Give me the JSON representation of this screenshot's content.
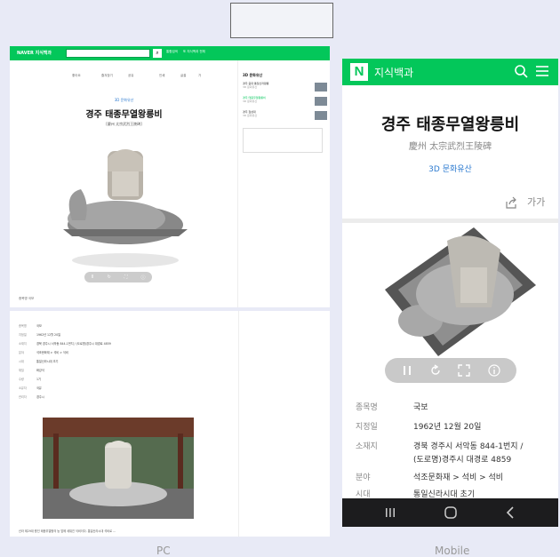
{
  "labels": {
    "pc": "PC",
    "mobile": "Mobile"
  },
  "pc": {
    "logo": "NAVER 지식백과",
    "search_value": "",
    "search_btn": "통합검색",
    "header_link": "또 지식백과 전체",
    "toolbar": [
      "좋아요",
      "즐겨찾기",
      "공유",
      "인쇄",
      "글꼴",
      "가"
    ],
    "subtitle": "3D 문화유산",
    "title": "경주 태종무열왕릉비",
    "hanja": "[慶州 太宗武烈王陵碑]",
    "controls": [
      "II",
      "↻",
      "⛶",
      "ⓘ"
    ],
    "meta": "종목명   국보",
    "side_title": "3D 문화유산",
    "side_items": [
      {
        "title": "경주 중대 통일신라왕릉",
        "source": "3D 문화유산",
        "active": false
      },
      {
        "title": "경주 태종무열왕릉비",
        "source": "3D 문화유산",
        "active": true
      },
      {
        "title": "경주 첨성대",
        "source": "3D 문화유산",
        "active": false
      }
    ],
    "info_rows": [
      {
        "k": "종목명",
        "v": "국보"
      },
      {
        "k": "지정일",
        "v": "1962년 12월 20일"
      },
      {
        "k": "소재지",
        "v": "경북 경주시 서악동 844-1번지 / (도로명)경주시 대경로 4859"
      },
      {
        "k": "분야",
        "v": "석조문화재 > 석비 > 석비"
      },
      {
        "k": "시대",
        "v": "통일신라시대 초기"
      },
      {
        "k": "재질",
        "v": "화강석"
      },
      {
        "k": "수량",
        "v": "1기"
      },
      {
        "k": "소유자",
        "v": "국유"
      },
      {
        "k": "관리자",
        "v": "경주시"
      }
    ],
    "caption": "신라 제29대 왕인 태종무열왕의 능 앞에 세워진 석비이다. 통일신라시대 석비로 ..."
  },
  "mobile": {
    "logo": "N",
    "brand": "지식백과",
    "title": "경주 태종무열왕릉비",
    "hanja": "慶州 太宗武烈王陵碑",
    "subtitle": "3D 문화유산",
    "font_label": "가가",
    "rows": [
      {
        "k": "종목명",
        "v": "국보"
      },
      {
        "k": "지정일",
        "v": "1962년 12월 20일"
      },
      {
        "k": "소재지",
        "v": "경북 경주시 서악동 844-1번지 /"
      },
      {
        "k": "",
        "v": "(도로명)경주시 대경로 4859"
      },
      {
        "k": "분야",
        "v": "석조문화재 > 석비 > 석비"
      },
      {
        "k": "시대",
        "v": "통일신라시대 초기"
      }
    ]
  }
}
